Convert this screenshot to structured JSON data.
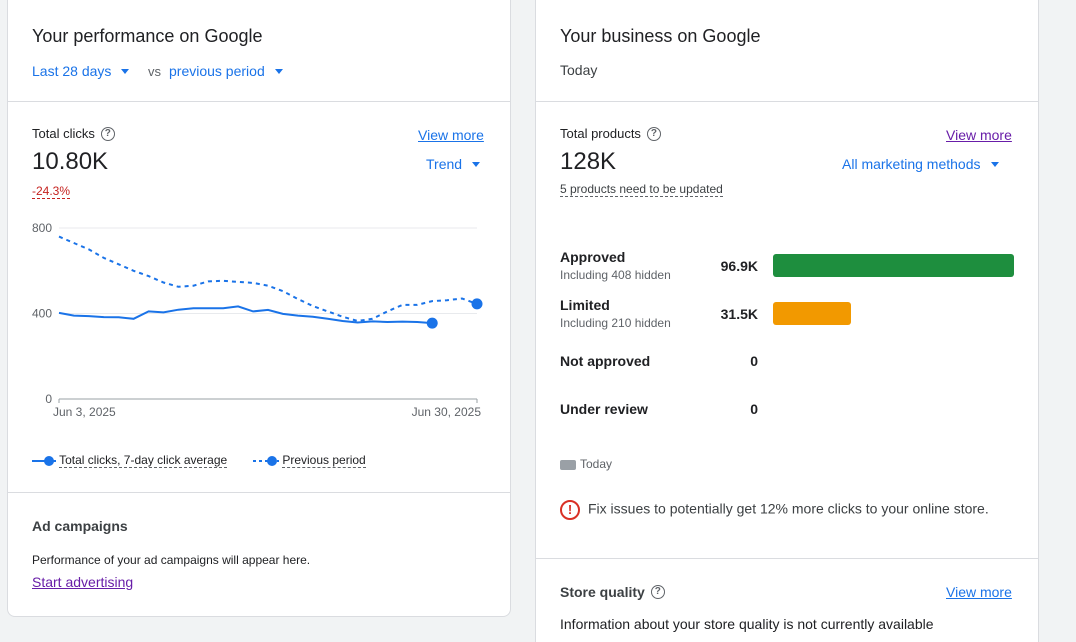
{
  "performance": {
    "title": "Your performance on Google",
    "range_label": "Last 28 days",
    "vs_label": "vs",
    "compare_label": "previous period",
    "metric_label": "Total clicks",
    "view_more": "View more",
    "metric_value": "10.80K",
    "change": "-24.3%",
    "trend_label": "Trend",
    "chart_data": {
      "type": "line",
      "x_start_label": "Jun 3, 2025",
      "x_end_label": "Jun 30, 2025",
      "y_ticks": [
        0,
        400,
        800
      ],
      "ylim": [
        0,
        800
      ],
      "grid": true,
      "legend_position": "bottom-left",
      "series": [
        {
          "name": "Total clicks, 7-day click average",
          "style": "solid",
          "color": "#1a73e8",
          "values": [
            403,
            390,
            388,
            383,
            382,
            375,
            410,
            405,
            418,
            425,
            425,
            425,
            433,
            410,
            417,
            398,
            390,
            385,
            375,
            365,
            358,
            363,
            360,
            362,
            360,
            355
          ]
        },
        {
          "name": "Previous period",
          "style": "dashed",
          "color": "#1a73e8",
          "values": [
            760,
            730,
            700,
            660,
            630,
            600,
            575,
            545,
            525,
            530,
            550,
            553,
            548,
            543,
            530,
            505,
            468,
            435,
            410,
            385,
            365,
            375,
            410,
            440,
            440,
            458,
            462,
            470,
            445
          ]
        }
      ]
    },
    "legend": {
      "current": "Total clicks, 7-day click average",
      "previous": "Previous period"
    },
    "ad_campaigns": {
      "title": "Ad campaigns",
      "text": "Performance of your ad campaigns will appear here.",
      "link": "Start advertising"
    }
  },
  "business": {
    "title": "Your business on Google",
    "subtitle": "Today",
    "metric_label": "Total products",
    "view_more": "View more",
    "metric_value": "128K",
    "method_label": "All marketing methods",
    "note": "5 products need to be updated",
    "bars": [
      {
        "label": "Approved",
        "sub": "Including 408 hidden",
        "value_label": "96.9K",
        "value": 96900,
        "color": "#1e8e3e"
      },
      {
        "label": "Limited",
        "sub": "Including 210 hidden",
        "value_label": "31.5K",
        "value": 31500,
        "color": "#f29900"
      },
      {
        "label": "Not approved",
        "sub": "",
        "value_label": "0",
        "value": 0,
        "color": "#9aa0a6"
      },
      {
        "label": "Under review",
        "sub": "",
        "value_label": "0",
        "value": 0,
        "color": "#9aa0a6"
      }
    ],
    "legend_label": "Today",
    "issue_text": "Fix issues to potentially get 12% more clicks to your online store.",
    "store_quality": {
      "title": "Store quality",
      "view_more": "View more",
      "text": "Information about your store quality is not currently available"
    }
  },
  "colors": {
    "accent": "#1a73e8",
    "negative": "#c5221f",
    "approved": "#1e8e3e",
    "limited": "#f29900",
    "link_visited": "#681da8"
  }
}
